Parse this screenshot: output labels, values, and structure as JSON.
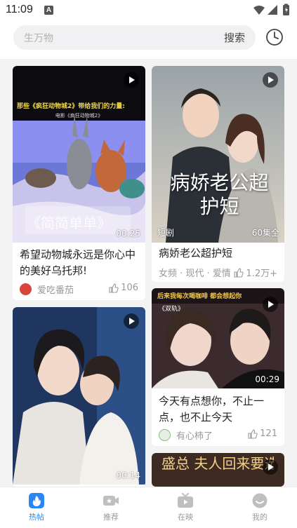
{
  "status_bar": {
    "time": "11:09",
    "notification_badge": "A"
  },
  "search": {
    "placeholder": "生万物",
    "button_label": "搜索"
  },
  "feed": {
    "cards": [
      {
        "overlay_title": "那些《疯狂动物城2》带给我们的力量:",
        "overlay_subtitle": "电影《疯狂动物城2》",
        "overlay_caption": "《简简单单》",
        "duration": "00:25",
        "title": "希望动物城永远是你心中的美好乌托邦!",
        "author": "爱吃番茄",
        "likes": "106"
      },
      {
        "overlay_title": "病娇老公超护短",
        "tag": "短剧",
        "episodes": "60集全",
        "title": "病娇老公超护短",
        "meta": "女频 · 现代 · 爱情",
        "likes": "1.2万+"
      },
      {
        "overlay_title": "后来我每次喝咖啡 都会想起你",
        "overlay_subtitle": "《双轨》",
        "duration": "00:29",
        "title": "今天有点想你，不止一点，也不止今天",
        "author": "有心柿了",
        "likes": "121"
      },
      {
        "duration": "00:14"
      },
      {
        "overlay_title": "盛总 夫人回来要选秀"
      }
    ]
  },
  "tabs": [
    {
      "label": "热帖",
      "icon": "flame-icon",
      "active": true
    },
    {
      "label": "推荐",
      "icon": "video-camera-icon",
      "active": false
    },
    {
      "label": "在映",
      "icon": "tv-play-icon",
      "active": false
    },
    {
      "label": "我的",
      "icon": "smile-face-icon",
      "active": false
    }
  ],
  "colors": {
    "accent": "#2a86f5",
    "background": "#f3f3f4"
  }
}
